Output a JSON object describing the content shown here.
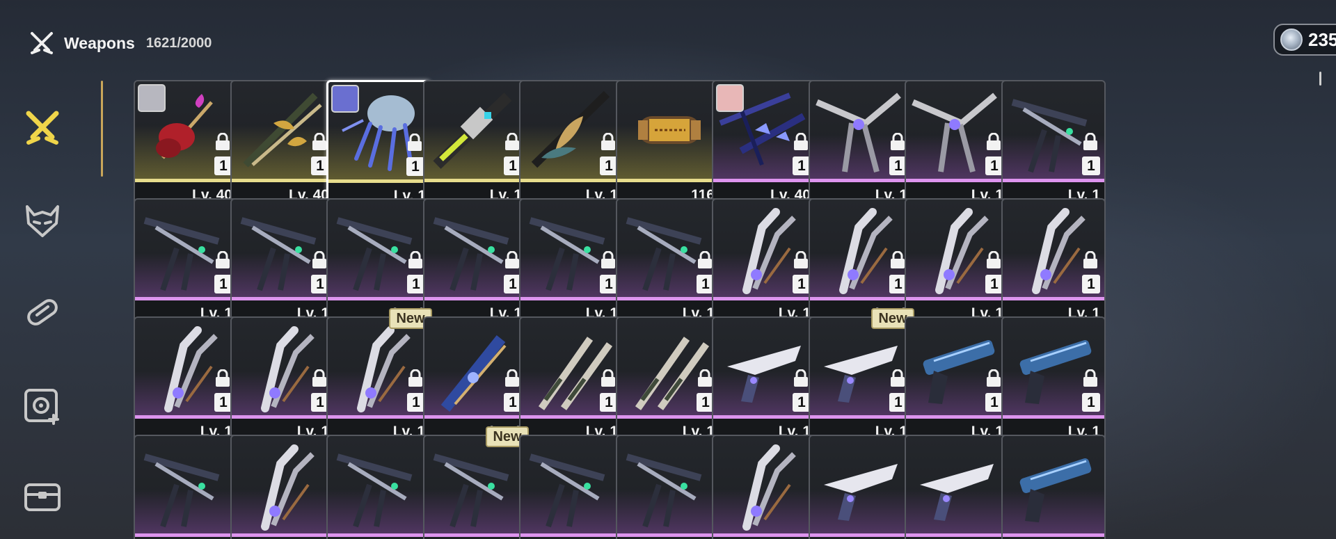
{
  "header": {
    "title": "Weapons",
    "count": "1621/2000",
    "icon": "crossed-swords-icon"
  },
  "currency": {
    "amount": "235",
    "icon": "coin-icon"
  },
  "sidebar": {
    "items": [
      {
        "name": "weapons",
        "icon": "crossed-swords-icon",
        "active": true
      },
      {
        "name": "echoes",
        "icon": "demon-mask-icon",
        "active": false
      },
      {
        "name": "materials",
        "icon": "capsule-icon",
        "active": false
      },
      {
        "name": "resonance",
        "icon": "vinyl-plus-icon",
        "active": false
      },
      {
        "name": "chest",
        "icon": "chest-icon",
        "active": false
      }
    ]
  },
  "colors": {
    "gold": "#e7dc8c",
    "purple": "#dd94ee",
    "accent": "#f0d54a"
  },
  "rows": [
    [
      {
        "label": "Lv. 40",
        "rank": "1",
        "rarity": "gold",
        "avatar": "#b7b7bf",
        "weapon": "red-guitar"
      },
      {
        "label": "Lv. 40",
        "rank": "1",
        "rarity": "gold",
        "weapon": "gold-sword"
      },
      {
        "label": "Lv. 1",
        "rank": "1",
        "rarity": "gold",
        "avatar": "#6a6fd0",
        "weapon": "jelly",
        "selected": true
      },
      {
        "label": "Lv. 1",
        "rank": "1",
        "rarity": "gold",
        "weapon": "tech-blade"
      },
      {
        "label": "Lv. 1",
        "rank": "1",
        "rarity": "gold",
        "weapon": "gold-spear"
      },
      {
        "label": "116",
        "rarity": "gold",
        "weapon": "capsule",
        "is_item": true
      },
      {
        "label": "Lv. 40",
        "rank": "1",
        "rarity": "purple",
        "avatar": "#e8b7b7",
        "weapon": "blue-cannon"
      },
      {
        "label": "Lv. 1",
        "rank": "1",
        "rarity": "purple",
        "weapon": "silver-cannon"
      },
      {
        "label": "Lv. 1",
        "rank": "1",
        "rarity": "purple",
        "weapon": "silver-cannon"
      },
      {
        "label": "Lv. 1",
        "rank": "1",
        "rarity": "purple",
        "weapon": "dark-cannon"
      }
    ],
    [
      {
        "label": "Lv. 1",
        "rank": "1",
        "rarity": "purple",
        "weapon": "dark-cannon"
      },
      {
        "label": "Lv. 1",
        "rank": "1",
        "rarity": "purple",
        "weapon": "dark-cannon"
      },
      {
        "label": "Lv. 1",
        "rank": "1",
        "rarity": "purple",
        "weapon": "dark-cannon"
      },
      {
        "label": "Lv. 1",
        "rank": "1",
        "rarity": "purple",
        "weapon": "dark-cannon"
      },
      {
        "label": "Lv. 1",
        "rank": "1",
        "rarity": "purple",
        "weapon": "dark-cannon"
      },
      {
        "label": "Lv. 1",
        "rank": "1",
        "rarity": "purple",
        "weapon": "dark-cannon"
      },
      {
        "label": "Lv. 1",
        "rank": "1",
        "rarity": "purple",
        "weapon": "silver-gauntlet"
      },
      {
        "label": "Lv. 1",
        "rank": "1",
        "rarity": "purple",
        "weapon": "silver-gauntlet"
      },
      {
        "label": "Lv. 1",
        "rank": "1",
        "rarity": "purple",
        "weapon": "silver-gauntlet"
      },
      {
        "label": "Lv. 1",
        "rank": "1",
        "rarity": "purple",
        "weapon": "silver-gauntlet"
      }
    ],
    [
      {
        "label": "Lv. 1",
        "rank": "1",
        "rarity": "purple",
        "weapon": "silver-gauntlet"
      },
      {
        "label": "Lv. 1",
        "rank": "1",
        "rarity": "purple",
        "weapon": "silver-gauntlet"
      },
      {
        "label": "Lv. 1",
        "rank": "1",
        "rarity": "purple",
        "weapon": "silver-gauntlet",
        "badge": "New"
      },
      {
        "label": "Lv. 1",
        "rank": "1",
        "rarity": "purple",
        "weapon": "blue-rectifier"
      },
      {
        "label": "Lv. 1",
        "rank": "1",
        "rarity": "purple",
        "weapon": "twin-blades"
      },
      {
        "label": "Lv. 1",
        "rank": "1",
        "rarity": "purple",
        "weapon": "twin-blades"
      },
      {
        "label": "Lv. 1",
        "rank": "1",
        "rarity": "purple",
        "weapon": "white-pistol"
      },
      {
        "label": "Lv. 1",
        "rank": "1",
        "rarity": "purple",
        "weapon": "white-pistol",
        "badge": "New"
      },
      {
        "label": "Lv. 1",
        "rank": "1",
        "rarity": "purple",
        "weapon": "blue-pistol"
      },
      {
        "label": "Lv. 1",
        "rank": "1",
        "rarity": "purple",
        "weapon": "blue-pistol"
      }
    ],
    [
      {
        "weapon": "dark-cannon",
        "rarity": "purple"
      },
      {
        "weapon": "silver-gauntlet",
        "rarity": "purple"
      },
      {
        "weapon": "dark-cannon",
        "rarity": "purple"
      },
      {
        "weapon": "dark-cannon",
        "rarity": "purple",
        "badge": "New"
      },
      {
        "weapon": "dark-cannon",
        "rarity": "purple"
      },
      {
        "weapon": "dark-cannon",
        "rarity": "purple"
      },
      {
        "weapon": "silver-gauntlet",
        "rarity": "purple"
      },
      {
        "weapon": "white-pistol",
        "rarity": "purple"
      },
      {
        "weapon": "white-pistol",
        "rarity": "purple"
      },
      {
        "weapon": "blue-pistol",
        "rarity": "purple"
      }
    ]
  ]
}
